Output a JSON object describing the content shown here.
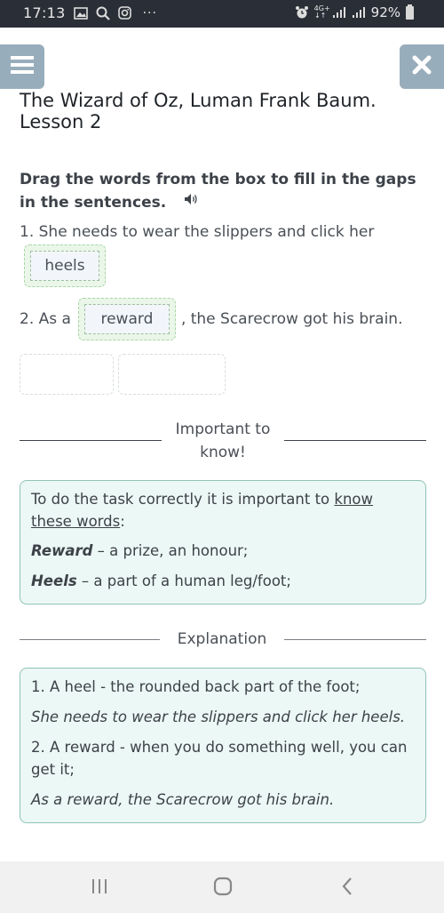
{
  "status_bar": {
    "time": "17:13",
    "left_icons": [
      "gallery-icon",
      "search-icon",
      "instagram-icon"
    ],
    "more": "···",
    "network": "4G+",
    "battery": "92%"
  },
  "header": {
    "menu_icon": "hamburger-icon",
    "close_icon": "close-icon",
    "title": "The Wizard of Oz, Luman Frank Baum. Lesson 2"
  },
  "exercise": {
    "instruction": "Drag the words from the box to fill in the gaps in the sentences.",
    "sentence1": {
      "text": "1. She needs to wear the slippers and click her",
      "answer": "heels"
    },
    "sentence2": {
      "before": "2. As a",
      "answer": "reward",
      "after": ", the Scarecrow got his brain."
    },
    "word_bank_slots": [
      "",
      ""
    ]
  },
  "important": {
    "heading": "Important to know!",
    "intro_before": "To do the task correctly it is important to ",
    "intro_link": "know these words",
    "intro_after": ":",
    "terms": [
      {
        "term": "Reward",
        "definition": " – a prize, an honour;"
      },
      {
        "term": "Heels",
        "definition": " – a part of a human leg/foot;"
      }
    ]
  },
  "explanation": {
    "heading": "Explanation",
    "lines": [
      "1. A heel - the rounded back part of the foot;",
      "She needs to wear the slippers and click her heels.",
      "2. A reward - when you do something well, you can get it;",
      "As a reward, the Scarecrow got his brain."
    ]
  },
  "nav_bar": {
    "buttons": [
      "recent-apps",
      "home",
      "back"
    ]
  },
  "colors": {
    "status_bar_bg": "#2a2e36",
    "header_button_bg": "#98adbb",
    "drop_zone_bg": "#eaf6e8",
    "info_box_bg": "#ecf8f5",
    "info_box_border": "#8fc3b7"
  }
}
